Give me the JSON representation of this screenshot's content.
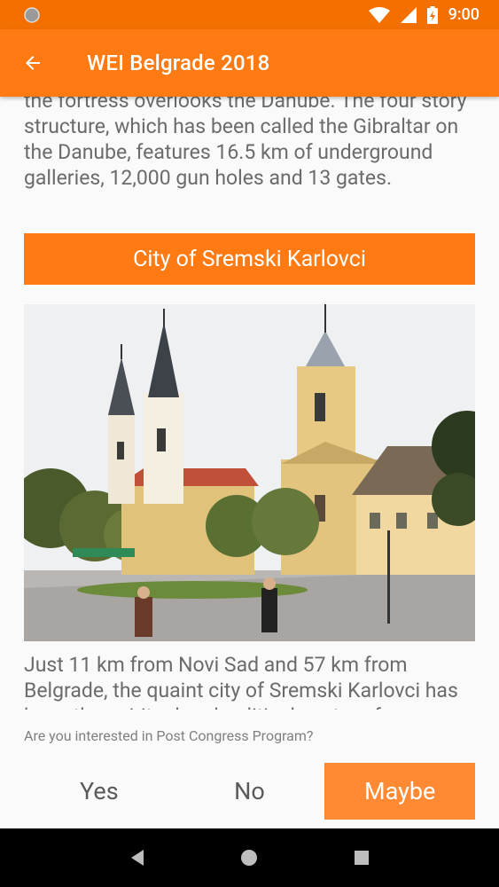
{
  "status_bar": {
    "time": "9:00"
  },
  "app_bar": {
    "title": "WEI Belgrade 2018"
  },
  "content": {
    "intro_paragraph": "the fortress overlooks the Danube. The four story structure, which has been called the Gibraltar on the Danube, features 16.5 km of underground galleries, 12,000 gun holes and 13 gates.",
    "section_title": "City of Sremski Karlovci",
    "section_paragraph": "Just 11 km from Novi Sad and 57 km from Belgrade, the quaint city of Sremski Karlovci has been the spiritual and political center of"
  },
  "poll": {
    "question": "Are you interested in Post Congress Program?",
    "options": [
      "Yes",
      "No",
      "Maybe"
    ],
    "selected": "Maybe"
  },
  "colors": {
    "primary": "#ff7a12",
    "status_bar": "#f26f00",
    "selected_option": "#ff8a33"
  }
}
